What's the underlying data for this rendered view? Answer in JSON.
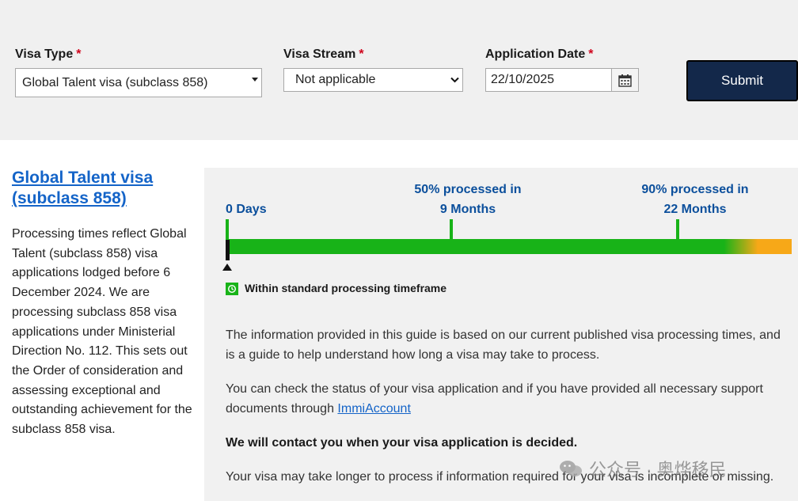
{
  "form": {
    "visa_type": {
      "label": "Visa Type",
      "required_mark": "*",
      "value": "Global Talent visa (subclass 858)"
    },
    "visa_stream": {
      "label": "Visa Stream",
      "required_mark": "*",
      "value": "Not applicable"
    },
    "application_date": {
      "label": "Application Date",
      "required_mark": "*",
      "value": "22/10/2025"
    },
    "submit_label": "Submit"
  },
  "visa": {
    "title": "Global Talent visa (subclass 858)",
    "description": "Processing times reflect Global Talent (subclass 858) visa applications lodged before 6 December 2024. We are processing subclass 858 visa applications under Ministerial Direction No. 112. This sets out the Order of consideration and assessing exceptional and outstanding achievement for the subclass 858 visa."
  },
  "timeline": {
    "start_label": "0 Days",
    "p50_line1": "50% processed in",
    "p50_line2": "9 Months",
    "p90_line1": "90% processed in",
    "p90_line2": "22 Months",
    "legend": "Within standard processing timeframe"
  },
  "content": {
    "para1": "The information provided in this guide is based on our current published visa processing times, and is a guide to help understand how long a visa may take to process.",
    "para2_before": "You can check the status of your visa application and if you have provided all necessary support documents through ",
    "para2_link": "ImmiAccount",
    "para3": "We will contact you when your visa application is decided.",
    "para4": "Your visa may take longer to process if information required for your visa is incomplete or missing."
  },
  "watermark": "公众号 · 奥烨移民",
  "colors": {
    "accent": "#1464c8",
    "submit_bg": "#13284a",
    "bar_green": "#18b318",
    "bar_amber": "#f7a818"
  }
}
